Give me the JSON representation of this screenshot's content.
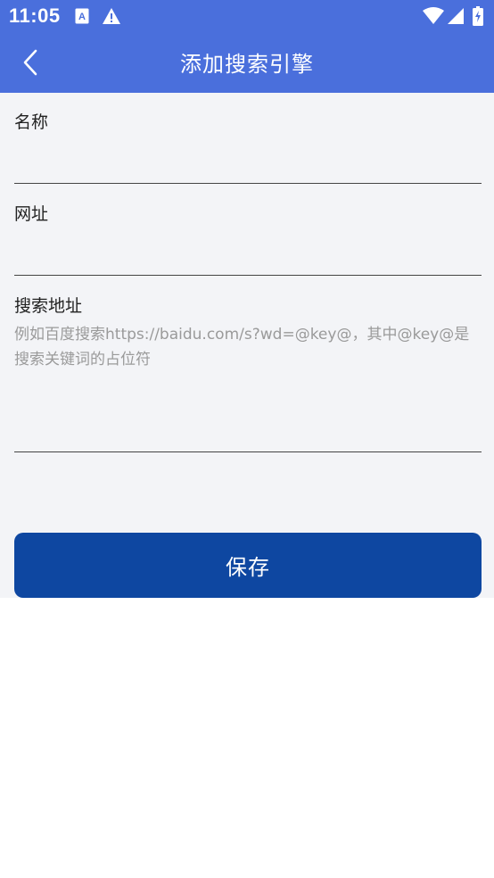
{
  "status_bar": {
    "time": "11:05",
    "icons": [
      "font-a-icon",
      "warning-icon",
      "wifi-icon",
      "signal-icon",
      "battery-charging-icon"
    ]
  },
  "app_bar": {
    "title": "添加搜索引擎",
    "back_icon": "chevron-left-icon"
  },
  "form": {
    "name": {
      "label": "名称",
      "value": ""
    },
    "url": {
      "label": "网址",
      "value": ""
    },
    "search_url": {
      "label": "搜索地址",
      "value": "",
      "placeholder": "例如百度搜索https://baidu.com/s?wd=@key@，其中@key@是搜索关键词的占位符"
    }
  },
  "save_button": {
    "label": "保存"
  },
  "colors": {
    "header": "#4a6fdc",
    "content_background": "#f3f4f7",
    "button": "#0e47a1",
    "placeholder": "#9a9a9a"
  }
}
